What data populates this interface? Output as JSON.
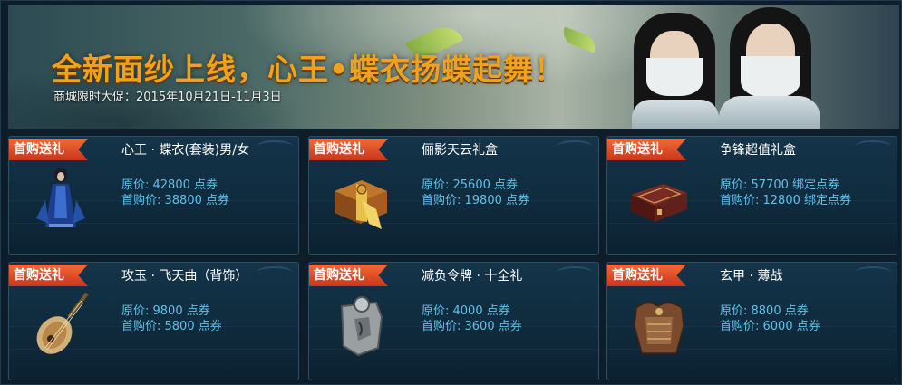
{
  "banner": {
    "title": "全新面纱上线，心王•蝶衣扬蝶起舞！",
    "subtitle": "商城限时大促：2015年10月21日-11月3日"
  },
  "items": [
    {
      "tag": "首购送礼",
      "name": "心王 · 蝶衣(套装)男/女",
      "price_original": "原价: 42800 点券",
      "price_first": "首购价: 38800 点券",
      "icon": "costume-figure-icon"
    },
    {
      "tag": "首购送礼",
      "name": "俪影天云礼盒",
      "price_original": "原价: 25600 点券",
      "price_first": "首购价: 19800 点券",
      "icon": "gift-box-icon"
    },
    {
      "tag": "首购送礼",
      "name": "争锋超值礼盒",
      "price_original": "原价: 57700 绑定点券",
      "price_first": "首购价: 12800 绑定点券",
      "icon": "chest-icon"
    },
    {
      "tag": "首购送礼",
      "name": "攻玉 · 飞天曲（背饰）",
      "price_original": "原价: 9800 点券",
      "price_first": "首购价: 5800 点券",
      "icon": "pipa-icon"
    },
    {
      "tag": "首购送礼",
      "name": "减负令牌 · 十全礼",
      "price_original": "原价: 4000 点券",
      "price_first": "首购价: 3600 点券",
      "icon": "token-icon"
    },
    {
      "tag": "首购送礼",
      "name": "玄甲 · 薄战",
      "price_original": "原价: 8800 点券",
      "price_first": "首购价: 6000 点券",
      "icon": "armor-icon"
    }
  ],
  "colors": {
    "accent_orange": "#f2a11a",
    "tag_red": "#d9431f",
    "price_blue": "#5fc1ec",
    "panel_bg": "#0f2a3c"
  }
}
